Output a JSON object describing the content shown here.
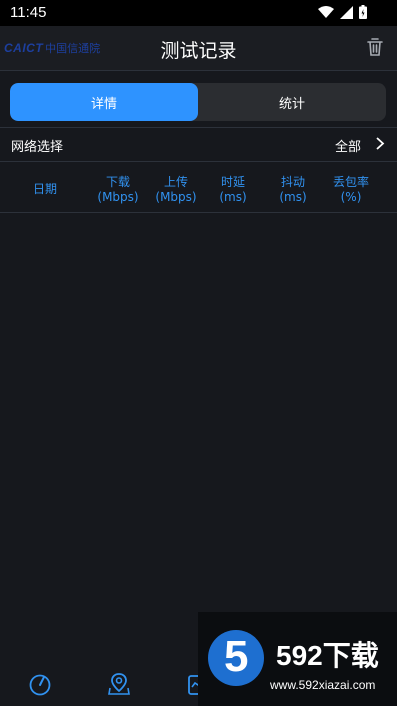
{
  "status_bar": {
    "time": "11:45"
  },
  "header": {
    "logo_en": "CAICT",
    "logo_cn": "中国信通院",
    "title": "测试记录"
  },
  "tabs": [
    {
      "label": "详情",
      "active": true
    },
    {
      "label": "统计",
      "active": false
    }
  ],
  "network": {
    "label": "网络选择",
    "value": "全部"
  },
  "table": {
    "columns": [
      {
        "line1": "日期",
        "line2": ""
      },
      {
        "line1": "下载",
        "line2": "(Mbps)"
      },
      {
        "line1": "上传",
        "line2": "(Mbps)"
      },
      {
        "line1": "时延",
        "line2": "(ms)"
      },
      {
        "line1": "抖动",
        "line2": "(ms)"
      },
      {
        "line1": "丢包率",
        "line2": "(%)"
      }
    ],
    "rows": []
  },
  "watermark": {
    "brand": "592下载",
    "digit": "5",
    "site": "www.592xiazai.com"
  },
  "colors": {
    "accent": "#2e93ff",
    "header_text": "#3192f0",
    "background": "#16181d"
  }
}
